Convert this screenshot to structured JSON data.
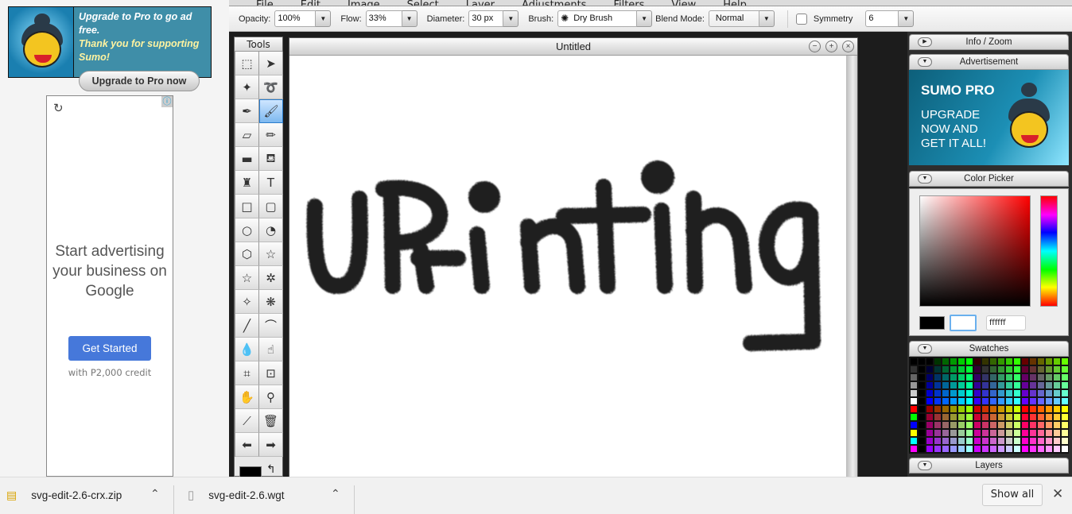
{
  "left_ads": {
    "sumo_banner": {
      "line1": "Upgrade to Pro to go ad free.",
      "line2": "Thank you for supporting Sumo!",
      "button": "Upgrade to Pro now"
    },
    "google_ad": {
      "headline": "Start advertising your business on Google",
      "cta": "Get Started",
      "subtext": "with P2,000 credit",
      "refresh_icon": "refresh-icon",
      "info_icon": "info-icon"
    }
  },
  "menu": [
    "File",
    "Edit",
    "Image",
    "Select",
    "Layer",
    "Adjustments",
    "Filters",
    "View",
    "Help"
  ],
  "options": {
    "opacity_label": "Opacity:",
    "opacity": "100%",
    "flow_label": "Flow:",
    "flow": "33%",
    "diameter_label": "Diameter:",
    "diameter": "30 px",
    "brush_label": "Brush:",
    "brush": "Dry Brush",
    "blend_label": "Blend Mode:",
    "blend": "Normal",
    "symmetry_label": "Symmetry",
    "symmetry_checked": false,
    "symmetry": "6"
  },
  "tools": {
    "title": "Tools",
    "items": [
      {
        "name": "rect-select",
        "glyph": "⬚"
      },
      {
        "name": "move",
        "glyph": "➤"
      },
      {
        "name": "magic-wand",
        "glyph": "✦"
      },
      {
        "name": "lasso",
        "glyph": "➰"
      },
      {
        "name": "pen",
        "glyph": "✒"
      },
      {
        "name": "brush",
        "glyph": "🖌"
      },
      {
        "name": "eraser",
        "glyph": "▱"
      },
      {
        "name": "pencil",
        "glyph": "✏"
      },
      {
        "name": "gradient",
        "glyph": "▬"
      },
      {
        "name": "paint-bucket",
        "glyph": "⛾"
      },
      {
        "name": "stamp",
        "glyph": "♜"
      },
      {
        "name": "text",
        "glyph": "T"
      },
      {
        "name": "rectangle",
        "glyph": "□"
      },
      {
        "name": "rounded-rectangle",
        "glyph": "▢"
      },
      {
        "name": "ellipse",
        "glyph": "○"
      },
      {
        "name": "pie",
        "glyph": "◔"
      },
      {
        "name": "hexagon",
        "glyph": "⬡"
      },
      {
        "name": "star",
        "glyph": "☆"
      },
      {
        "name": "star-5",
        "glyph": "☆"
      },
      {
        "name": "burst",
        "glyph": "✲"
      },
      {
        "name": "custom-shape",
        "glyph": "✧"
      },
      {
        "name": "flower",
        "glyph": "❋"
      },
      {
        "name": "line",
        "glyph": "╱"
      },
      {
        "name": "curve",
        "glyph": "⌒"
      },
      {
        "name": "blur-drop",
        "glyph": "💧"
      },
      {
        "name": "smudge",
        "glyph": "☝"
      },
      {
        "name": "crop",
        "glyph": "⌗"
      },
      {
        "name": "transform",
        "glyph": "⊡"
      },
      {
        "name": "hand",
        "glyph": "✋"
      },
      {
        "name": "zoom",
        "glyph": "⚲"
      },
      {
        "name": "eyedropper",
        "glyph": "⟋"
      },
      {
        "name": "trash",
        "glyph": "🗑"
      },
      {
        "name": "undo-arrow",
        "glyph": "⬅"
      },
      {
        "name": "redo-arrow",
        "glyph": "➡"
      }
    ],
    "active": "brush",
    "foreground_color": "#000000"
  },
  "document": {
    "title": "Untitled",
    "canvas_text": "UPrinting",
    "buttons": [
      "minimize",
      "maximize",
      "close"
    ]
  },
  "panels": {
    "info_zoom": "Info / Zoom",
    "advertisement": "Advertisement",
    "ad": {
      "title": "SUMO PRO",
      "body1": "UPGRADE",
      "body2": "NOW AND",
      "body3": "GET IT ALL!"
    },
    "color_picker": "Color Picker",
    "hex_value": "ffffff",
    "primary_color": "#000000",
    "secondary_color": "#ffffff",
    "swatches": "Swatches",
    "layers": "Layers"
  },
  "downloads": {
    "items": [
      {
        "name": "svg-edit-2.6-crx.zip",
        "icon": "zip-file-icon"
      },
      {
        "name": "svg-edit-2.6.wgt",
        "icon": "file-icon"
      }
    ],
    "show_all": "Show all"
  }
}
